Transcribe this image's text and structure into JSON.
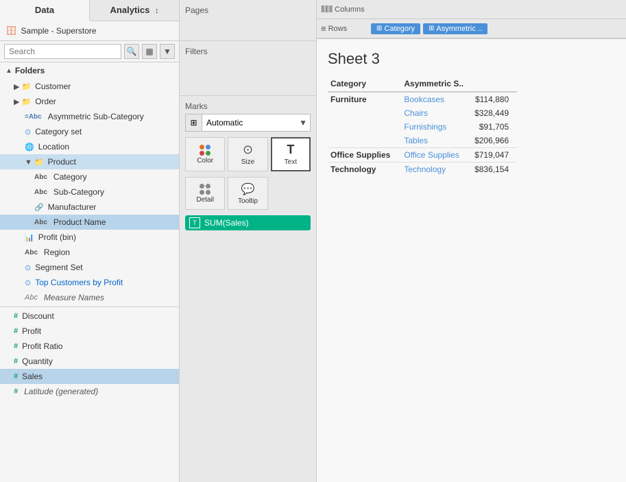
{
  "tabs": {
    "left": [
      {
        "label": "Data",
        "active": true
      },
      {
        "label": "Analytics",
        "active": false,
        "suffix": "↕"
      }
    ]
  },
  "datasource": {
    "name": "Sample - Superstore"
  },
  "search": {
    "placeholder": "Search"
  },
  "folders": [
    {
      "name": "Folders",
      "items": [
        {
          "name": "Customer",
          "type": "folder",
          "indent": 0
        },
        {
          "name": "Order",
          "type": "folder",
          "indent": 0
        },
        {
          "name": "Asymmetric Sub-Category",
          "type": "dim-abc",
          "indent": 1
        },
        {
          "name": "Category set",
          "type": "set",
          "indent": 1
        },
        {
          "name": "Location",
          "type": "geo",
          "indent": 1
        },
        {
          "name": "Product",
          "type": "folder-open",
          "indent": 1,
          "selected": true
        },
        {
          "name": "Category",
          "type": "abc",
          "indent": 2
        },
        {
          "name": "Sub-Category",
          "type": "abc",
          "indent": 2
        },
        {
          "name": "Manufacturer",
          "type": "link-abc",
          "indent": 2
        },
        {
          "name": "Product Name",
          "type": "abc",
          "indent": 2
        },
        {
          "name": "Profit (bin)",
          "type": "meas-bin",
          "indent": 1
        },
        {
          "name": "Region",
          "type": "abc",
          "indent": 1
        },
        {
          "name": "Segment Set",
          "type": "set",
          "indent": 1
        },
        {
          "name": "Top Customers by Profit",
          "type": "set-link",
          "indent": 1
        },
        {
          "name": "Measure Names",
          "type": "italic-abc",
          "indent": 1
        }
      ]
    }
  ],
  "measures": [
    {
      "name": "Discount",
      "type": "hash"
    },
    {
      "name": "Profit",
      "type": "hash"
    },
    {
      "name": "Profit Ratio",
      "type": "hash"
    },
    {
      "name": "Quantity",
      "type": "hash"
    },
    {
      "name": "Sales",
      "type": "hash",
      "selected": true
    },
    {
      "name": "Latitude (generated)",
      "type": "italic-hash"
    }
  ],
  "panels": {
    "pages": "Pages",
    "filters": "Filters",
    "marks": "Marks"
  },
  "marks": {
    "dropdown": {
      "icon": "⊞",
      "label": "Automatic",
      "arrow": "▼"
    },
    "buttons": [
      {
        "icon": "●●\n●●",
        "label": "Color",
        "unicode": "⬤"
      },
      {
        "icon": "◉",
        "label": "Size"
      },
      {
        "icon": "T",
        "label": "Text",
        "active": true
      }
    ],
    "buttons2": [
      {
        "icon": "⬡⬡\n⬡⬡",
        "label": "Detail"
      },
      {
        "icon": "💬",
        "label": "Tooltip"
      }
    ],
    "pill": {
      "icon": "⊞",
      "label": "SUM(Sales)"
    }
  },
  "shelf": {
    "columns": {
      "label": "Columns",
      "icon": "|||",
      "pills": []
    },
    "rows": {
      "label": "Rows",
      "icon": "≡",
      "pills": [
        {
          "label": "Category",
          "icon": "⊞"
        },
        {
          "label": "Asymmetric ..",
          "icon": "⊞"
        }
      ]
    }
  },
  "sheet": {
    "title": "Sheet 3",
    "headers": [
      "Category",
      "Asymmetric S.."
    ],
    "rows": [
      {
        "category": "Furniture",
        "subcategories": [
          {
            "name": "Bookcases",
            "value": "$114,880"
          },
          {
            "name": "Chairs",
            "value": "$328,449"
          },
          {
            "name": "Furnishings",
            "value": "$91,705"
          },
          {
            "name": "Tables",
            "value": "$206,966"
          }
        ]
      },
      {
        "category": "Office Supplies",
        "subcategories": [
          {
            "name": "Office Supplies",
            "value": "$719,047"
          }
        ]
      },
      {
        "category": "Technology",
        "subcategories": [
          {
            "name": "Technology",
            "value": "$836,154"
          }
        ]
      }
    ]
  }
}
